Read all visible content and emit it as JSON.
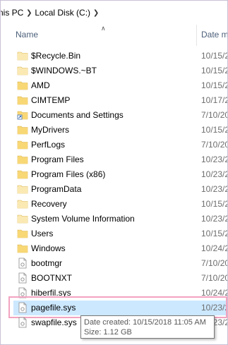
{
  "breadcrumb": {
    "items": [
      "nis PC",
      "Local Disk (C:)"
    ]
  },
  "columns": {
    "name": "Name",
    "date": "Date m"
  },
  "files": [
    {
      "name": "$Recycle.Bin",
      "date": "10/15/2",
      "icon": "folder-light-icon"
    },
    {
      "name": "$WINDOWS.~BT",
      "date": "10/15/2",
      "icon": "folder-light-icon"
    },
    {
      "name": "AMD",
      "date": "10/15/2",
      "icon": "folder-icon"
    },
    {
      "name": "CIMTEMP",
      "date": "10/17/2",
      "icon": "folder-icon"
    },
    {
      "name": "Documents and Settings",
      "date": "7/10/20",
      "icon": "shortcut-folder-icon"
    },
    {
      "name": "MyDrivers",
      "date": "10/15/2",
      "icon": "folder-icon"
    },
    {
      "name": "PerfLogs",
      "date": "7/10/20",
      "icon": "folder-icon"
    },
    {
      "name": "Program Files",
      "date": "10/23/2",
      "icon": "folder-icon"
    },
    {
      "name": "Program Files (x86)",
      "date": "10/23/2",
      "icon": "folder-icon"
    },
    {
      "name": "ProgramData",
      "date": "10/23/2",
      "icon": "folder-light-icon"
    },
    {
      "name": "Recovery",
      "date": "10/15/2",
      "icon": "folder-light-icon"
    },
    {
      "name": "System Volume Information",
      "date": "10/23/2",
      "icon": "folder-light-icon"
    },
    {
      "name": "Users",
      "date": "10/15/2",
      "icon": "folder-icon"
    },
    {
      "name": "Windows",
      "date": "10/24/2",
      "icon": "folder-icon"
    },
    {
      "name": "bootmgr",
      "date": "7/10/20",
      "icon": "system-file-icon"
    },
    {
      "name": "BOOTNXT",
      "date": "7/10/20",
      "icon": "system-file-icon"
    },
    {
      "name": "hiberfil.sys",
      "date": "10/24/2",
      "icon": "system-file-icon"
    },
    {
      "name": "pagefile.sys",
      "date": "10/23/2",
      "icon": "system-file-icon",
      "selected": true
    },
    {
      "name": "swapfile.sys",
      "date": "10/23/2",
      "icon": "system-file-icon"
    }
  ],
  "tooltip": {
    "date_created": "Date created: 10/15/2018 11:05 AM",
    "size": "Size: 1.12 GB"
  },
  "colors": {
    "folder": "#f8d775",
    "folder_light": "#fbe9b3",
    "selection": "#cce8ff",
    "highlight_border": "#f2a3c0"
  }
}
